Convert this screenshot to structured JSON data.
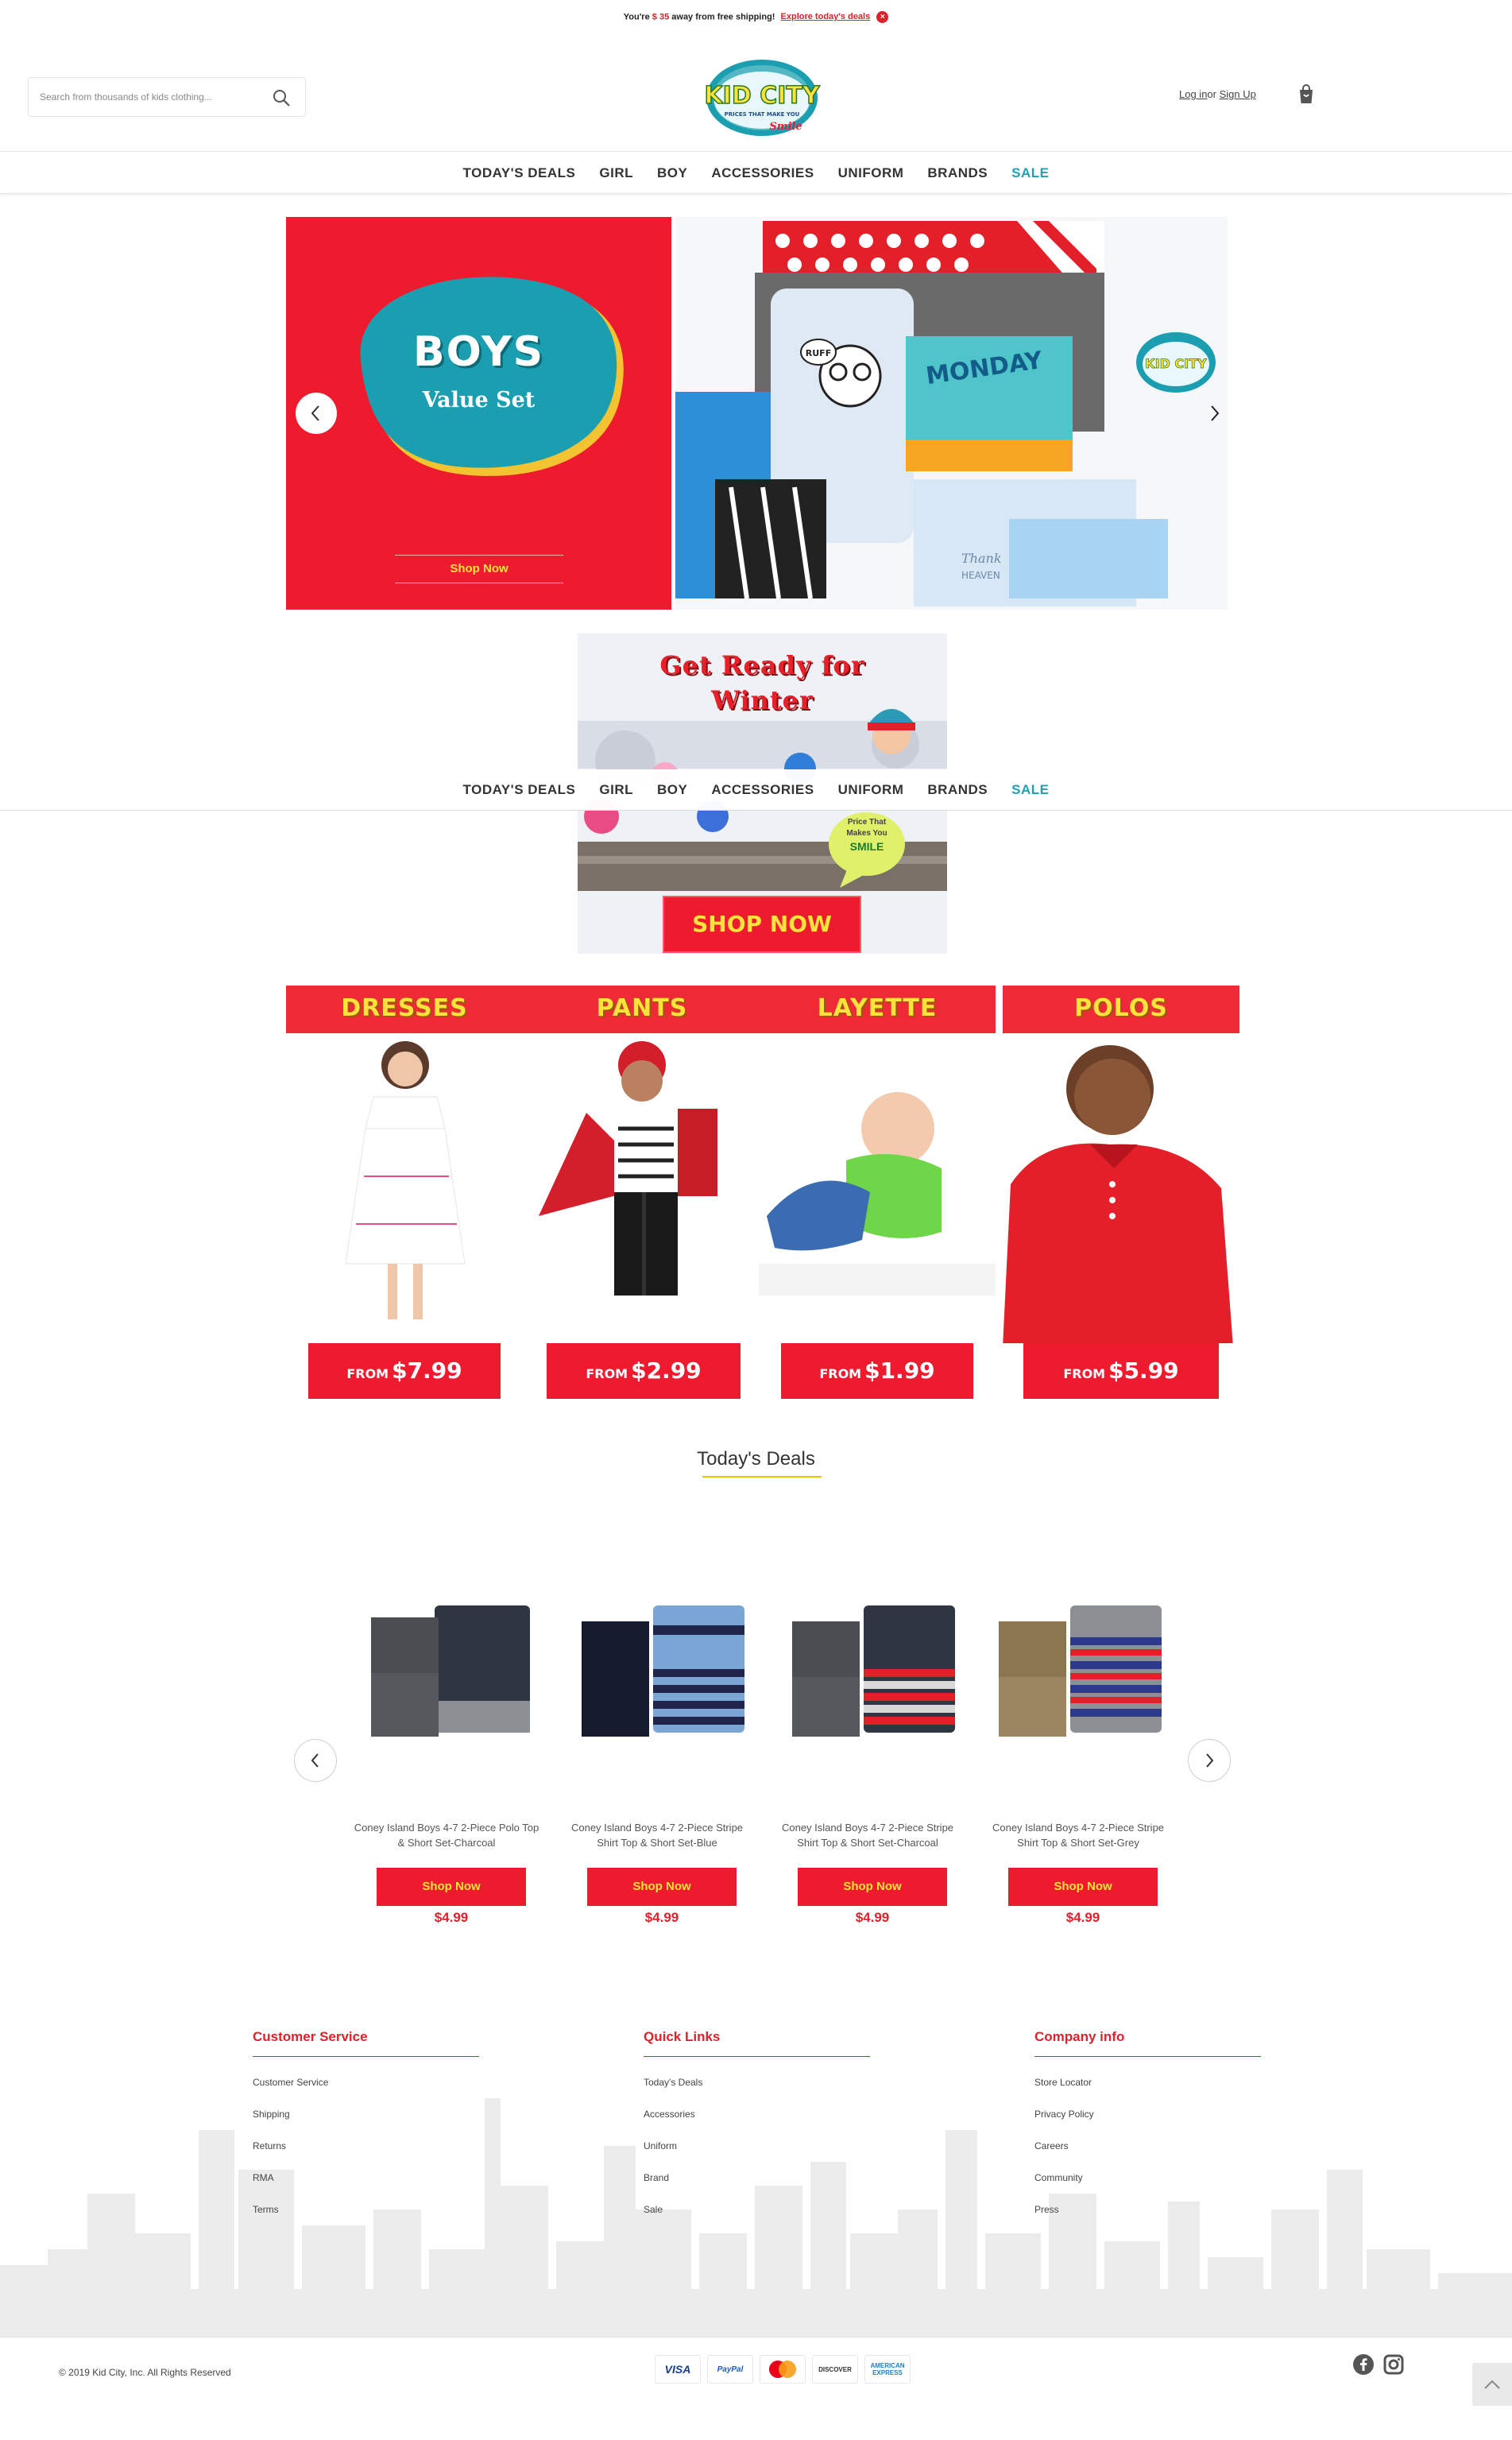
{
  "announcement": {
    "prefix": "You're",
    "amount": "$ 35",
    "suffix": "away from free shipping!",
    "link": "Explore today's deals",
    "close_glyph": "×"
  },
  "header": {
    "search_placeholder": "Search from thousands of kids clothing...",
    "search_icon": "search-icon",
    "logo_text": "KID CITY",
    "logo_tagline": "PRICES THAT MAKE YOU",
    "logo_script": "Smile",
    "login": "Log in",
    "or": "or",
    "signup": "Sign Up",
    "cart_icon": "shopping-bag-icon"
  },
  "nav": [
    "TODAY'S DEALS",
    "GIRL",
    "BOY",
    "ACCESSORIES",
    "UNIFORM",
    "BRANDS",
    "SALE"
  ],
  "hero": {
    "title": "BOYS",
    "subtitle": "Value Set",
    "cta": "Shop Now",
    "shirt_words": [
      "RUFF",
      "MONDAY",
      "Thank",
      "HEAVEN"
    ],
    "badge": "KID CITY",
    "colors": {
      "panel": "#ee1b2e",
      "blob": "#1b9fb0",
      "blob_edge": "#f3c331"
    }
  },
  "winter": {
    "title_line1": "Get Ready for",
    "title_line2": "Winter",
    "bubble": [
      "Price That",
      "Makes You",
      "SMILE"
    ],
    "cta": "SHOP NOW"
  },
  "categories": [
    {
      "title": "DRESSES",
      "from": "FROM",
      "price": "$7.99"
    },
    {
      "title": "PANTS",
      "from": "FROM",
      "price": "$2.99"
    },
    {
      "title": "LAYETTE",
      "from": "FROM",
      "price": "$1.99"
    },
    {
      "title": "POLOS",
      "from": "FROM",
      "price": "$5.99"
    }
  ],
  "deals": {
    "title": "Today's Deals",
    "products": [
      {
        "name": "Coney Island Boys 4-7 2-Piece Polo Top & Short Set-Charcoal",
        "cta": "Shop Now",
        "price": "$4.99"
      },
      {
        "name": "Coney Island Boys 4-7 2-Piece Stripe Shirt Top & Short Set-Blue",
        "cta": "Shop Now",
        "price": "$4.99"
      },
      {
        "name": "Coney Island Boys 4-7 2-Piece Stripe Shirt Top & Short Set-Charcoal",
        "cta": "Shop Now",
        "price": "$4.99"
      },
      {
        "name": "Coney Island Boys 4-7 2-Piece Stripe Shirt Top & Short Set-Grey",
        "cta": "Shop Now",
        "price": "$4.99"
      }
    ]
  },
  "footer": {
    "columns": [
      {
        "title": "Customer Service",
        "links": [
          "Customer Service",
          "Shipping",
          "Returns",
          "RMA",
          "Terms"
        ]
      },
      {
        "title": "Quick Links",
        "links": [
          "Today's Deals",
          "Accessories",
          "Uniform",
          "Brand",
          "Sale"
        ]
      },
      {
        "title": "Company info",
        "links": [
          "Store Locator",
          "Privacy Policy",
          "Careers",
          "Community",
          "Press"
        ]
      }
    ],
    "copyright": "© 2019 Kid City, Inc. All Rights Reserved",
    "payments": [
      "VISA",
      "PayPal",
      "Mastercard",
      "DISCOVER",
      "AMERICAN EXPRESS"
    ],
    "social_icons": [
      "facebook-icon",
      "instagram-icon"
    ],
    "accent": "#e0202a"
  }
}
